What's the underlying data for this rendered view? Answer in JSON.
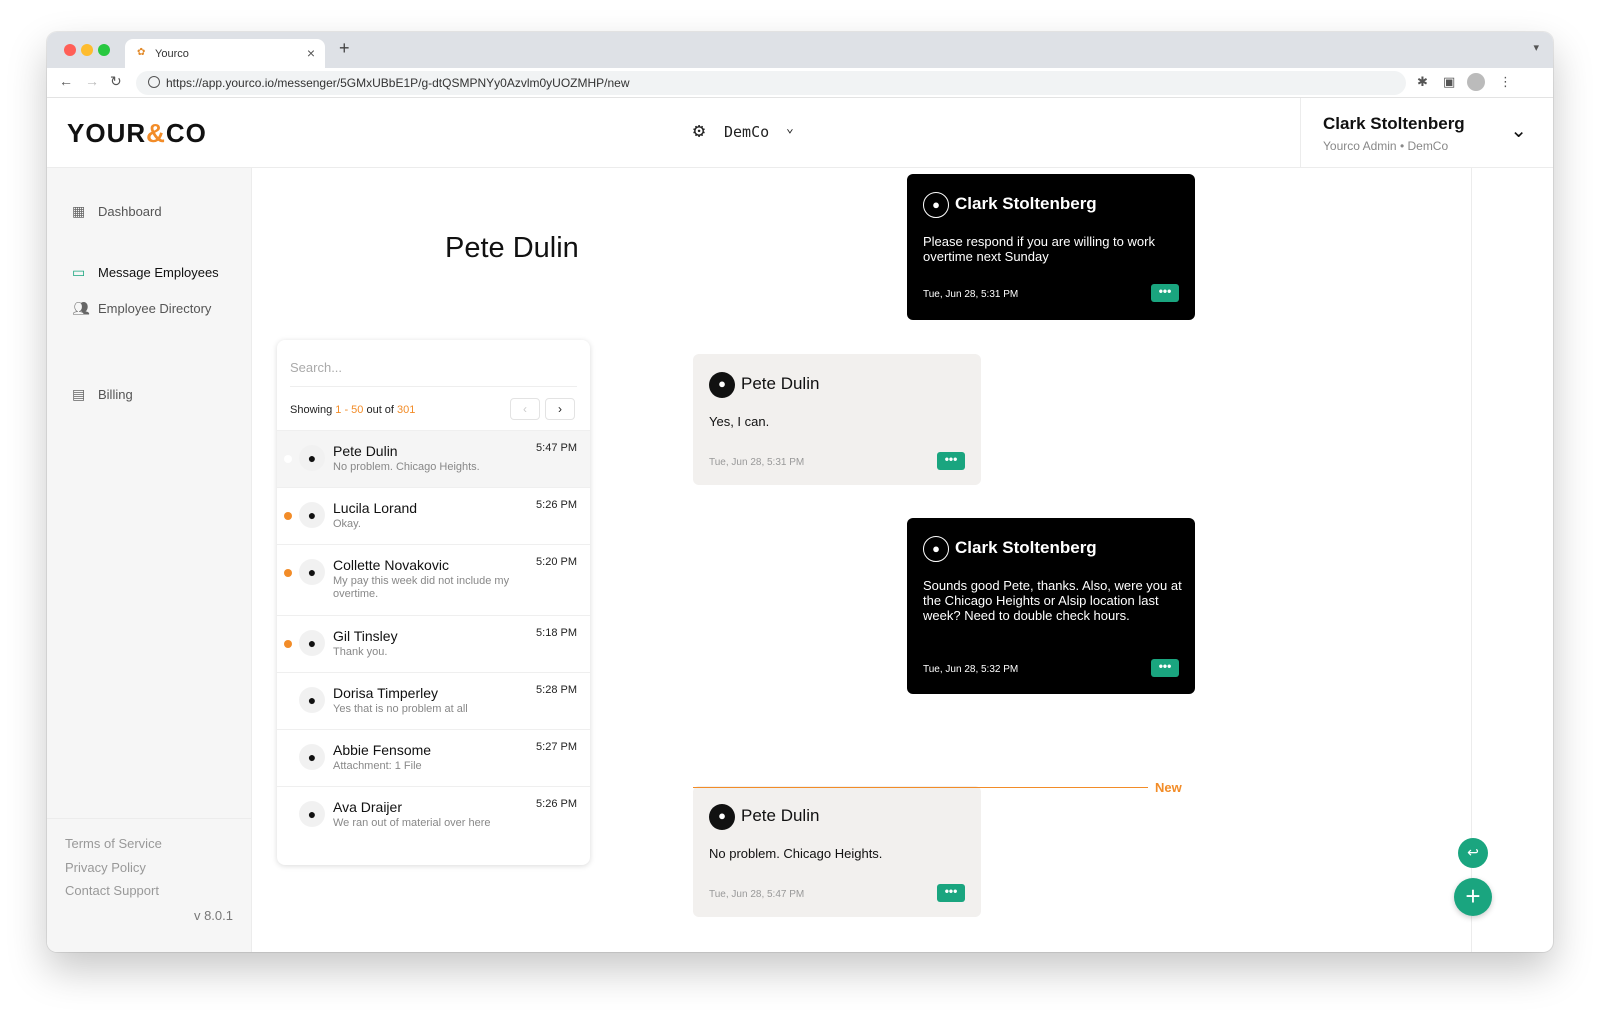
{
  "browser": {
    "tab_title": "Yourco",
    "tab_close": "×",
    "new_tab": "+",
    "url": "https://app.yourco.io/messenger/5GMxUBbE1P/g-dtQSMPNYy0Azvlm0yUOZMHP/new"
  },
  "header": {
    "logo_left": "YOUR",
    "logo_mid": "&",
    "logo_right": "CO",
    "org_name": "DemCo",
    "user_name": "Clark Stoltenberg",
    "user_role": "Yourco Admin • DemCo"
  },
  "sidebar": {
    "items": [
      {
        "label": "Dashboard",
        "icon": "dashboard-icon"
      },
      {
        "label": "Message Employees",
        "icon": "chat-icon"
      },
      {
        "label": "Employee Directory",
        "icon": "people-icon"
      },
      {
        "label": "Billing",
        "icon": "receipt-icon"
      }
    ],
    "footer": {
      "terms": "Terms of Service",
      "privacy": "Privacy Policy",
      "support": "Contact Support",
      "version": "v 8.0.1"
    }
  },
  "conversation": {
    "contact_name": "Pete Dulin",
    "search_placeholder": "Search...",
    "showing_prefix": "Showing ",
    "showing_range": "1 - 50",
    "showing_mid": " out of ",
    "showing_total": "301",
    "list": [
      {
        "name": "Pete Dulin",
        "preview": "No problem. Chicago Heights.",
        "time": "5:47 PM",
        "unread": false,
        "selected": true
      },
      {
        "name": "Lucila Lorand",
        "preview": "Okay.",
        "time": "5:26 PM",
        "unread": true,
        "selected": false
      },
      {
        "name": "Collette Novakovic",
        "preview": "My pay this week did not include my overtime.",
        "time": "5:20 PM",
        "unread": true,
        "selected": false
      },
      {
        "name": "Gil Tinsley",
        "preview": "Thank you.",
        "time": "5:18 PM",
        "unread": true,
        "selected": false
      },
      {
        "name": "Dorisa Timperley",
        "preview": "Yes that is no problem at all",
        "time": "5:28 PM",
        "unread": false,
        "selected": false
      },
      {
        "name": "Abbie Fensome",
        "preview": "Attachment: 1 File",
        "time": "5:27 PM",
        "unread": false,
        "selected": false
      },
      {
        "name": "Ava Draijer",
        "preview": "We ran out of material over here",
        "time": "5:26 PM",
        "unread": false,
        "selected": false
      }
    ]
  },
  "messages": [
    {
      "sender": "Clark Stoltenberg",
      "text": "Please respond if you are willing to work overtime next Sunday",
      "date": "Tue, Jun 28, 5:31 PM",
      "outgoing": true
    },
    {
      "sender": "Pete Dulin",
      "text": "Yes, I can.",
      "date": "Tue, Jun 28, 5:31 PM",
      "outgoing": false
    },
    {
      "sender": "Clark Stoltenberg",
      "text": "Sounds good Pete, thanks. Also, were you at the Chicago Heights or Alsip location last week? Need to double check hours.",
      "date": "Tue, Jun 28, 5:32 PM",
      "outgoing": true
    },
    {
      "sender": "Pete Dulin",
      "text": "No problem. Chicago Heights.",
      "date": "Tue, Jun 28, 5:47 PM",
      "outgoing": false
    }
  ],
  "new_divider": "New",
  "more_label": "•••",
  "colors": {
    "accent": "#1aa57f",
    "unread": "#f28c28",
    "outgoing_bubble": "#000000",
    "incoming_bubble": "#f2f0ee"
  }
}
